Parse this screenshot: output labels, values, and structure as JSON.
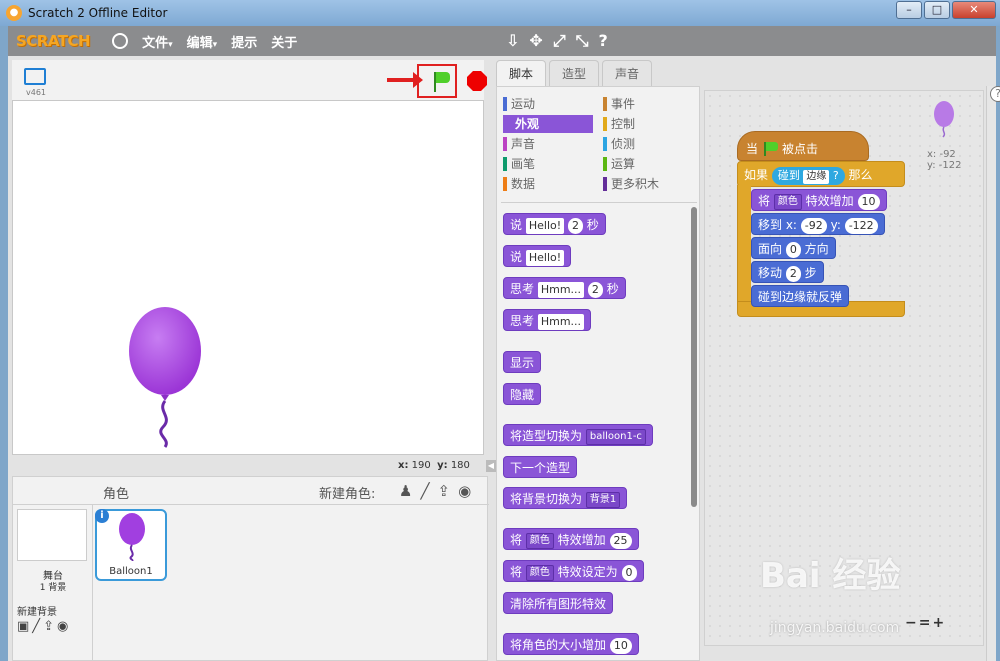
{
  "window": {
    "title": "Scratch 2 Offline Editor",
    "minimize": "–",
    "maximize": "□",
    "close": "✕"
  },
  "menubar": {
    "logo": "SCRATCH",
    "items": [
      "文件",
      "编辑",
      "提示",
      "关于"
    ],
    "caret": "▾",
    "tool_icons": [
      "⇩",
      "✥",
      "⤢",
      "⤡",
      "?"
    ]
  },
  "stage": {
    "version": "v461",
    "mouse_x_label": "x:",
    "mouse_x": "190",
    "mouse_y_label": "y:",
    "mouse_y": "180",
    "collapse": "◀"
  },
  "sprites": {
    "header_label": "角色",
    "new_sprite_label": "新建角色:",
    "new_sprite_icons": [
      "♟",
      "╱",
      "⇪",
      "◉"
    ],
    "stage_label": "舞台",
    "stage_backdrops": "1 背景",
    "new_backdrop_label": "新建背景",
    "new_backdrop_icons": [
      "▣",
      "╱",
      "⇪",
      "◉"
    ],
    "selected_sprite": "Balloon1",
    "info": "i"
  },
  "tabs": [
    "脚本",
    "造型",
    "声音"
  ],
  "categories": [
    {
      "label": "运动",
      "color": "#4a6cd4"
    },
    {
      "label": "外观",
      "color": "#8a55d7"
    },
    {
      "label": "声音",
      "color": "#bb42c3"
    },
    {
      "label": "画笔",
      "color": "#0e9a6c"
    },
    {
      "label": "数据",
      "color": "#ee7d16"
    },
    {
      "label": "事件",
      "color": "#c88330"
    },
    {
      "label": "控制",
      "color": "#e1a91a"
    },
    {
      "label": "侦测",
      "color": "#2ca5e2"
    },
    {
      "label": "运算",
      "color": "#5cb712"
    },
    {
      "label": "更多积木",
      "color": "#632d99"
    }
  ],
  "palette_blocks": {
    "say_secs": {
      "say": "说",
      "text": "Hello!",
      "secs": "2",
      "unit": "秒"
    },
    "say": {
      "say": "说",
      "text": "Hello!"
    },
    "think_secs": {
      "think": "思考",
      "text": "Hmm...",
      "secs": "2",
      "unit": "秒"
    },
    "think": {
      "think": "思考",
      "text": "Hmm..."
    },
    "show": "显示",
    "hide": "隐藏",
    "switch_costume": {
      "label": "将造型切换为",
      "value": "balloon1-c"
    },
    "next_costume": "下一个造型",
    "switch_backdrop": {
      "label": "将背景切换为",
      "value": "背景1"
    },
    "change_effect": {
      "pre": "将",
      "effect": "颜色",
      "post": "特效增加",
      "value": "25"
    },
    "set_effect": {
      "pre": "将",
      "effect": "颜色",
      "post": "特效设定为",
      "value": "0"
    },
    "clear_effects": "清除所有图形特效",
    "change_size": {
      "label": "将角色的大小增加",
      "value": "10"
    }
  },
  "script": {
    "hat": {
      "pre": "当",
      "post": "被点击"
    },
    "if": {
      "pre": "如果",
      "sense": "碰到",
      "target": "边缘",
      "q": "?",
      "post": "那么"
    },
    "change_effect": {
      "pre": "将",
      "effect": "颜色",
      "post": "特效增加",
      "value": "10"
    },
    "goto": {
      "label": "移到 x:",
      "x": "-92",
      "ylabel": "y:",
      "y": "-122"
    },
    "point": {
      "label": "面向",
      "value": "0",
      "post": "方向"
    },
    "move": {
      "label": "移动",
      "value": "2",
      "post": "步"
    },
    "bounce": "碰到边缘就反弹",
    "sprite_x": "x: -92",
    "sprite_y": "y: -122",
    "zoom": [
      "−",
      "=",
      "+"
    ]
  },
  "help": "?",
  "watermark": {
    "brand": "Bai 经验",
    "url": "jingyan.baidu.com"
  },
  "colors": {
    "looks": "#8a55d7",
    "events": "#c88330",
    "control": "#e0a72a",
    "sensing": "#2ea8e0",
    "motion": "#4a6cd4",
    "balloon": "#a13fe0"
  }
}
